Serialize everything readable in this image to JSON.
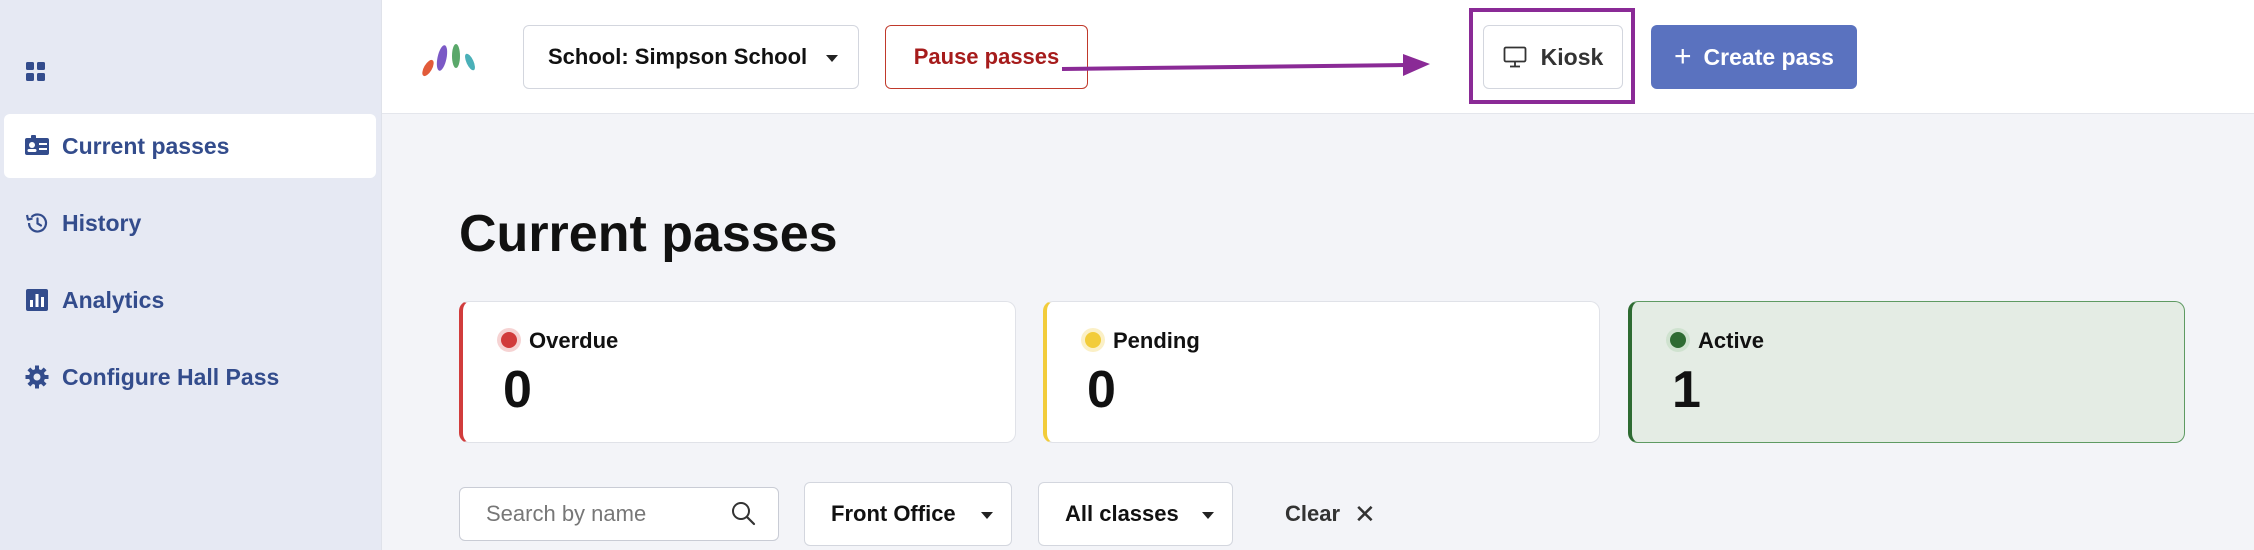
{
  "sidebar": {
    "items": [
      {
        "label": "Current passes",
        "icon": "badge-icon",
        "active": true
      },
      {
        "label": "History",
        "icon": "history-icon"
      },
      {
        "label": "Analytics",
        "icon": "bar-chart-icon"
      },
      {
        "label": "Configure Hall Pass",
        "icon": "gear-icon"
      }
    ]
  },
  "topbar": {
    "school_select": "School: Simpson School",
    "pause_label": "Pause passes",
    "kiosk_label": "Kiosk",
    "create_label": "Create pass"
  },
  "main": {
    "title": "Current passes",
    "cards": [
      {
        "label": "Overdue",
        "count": "0",
        "color": "#d13c3c"
      },
      {
        "label": "Pending",
        "count": "0",
        "color": "#f2cc3a"
      },
      {
        "label": "Active",
        "count": "1",
        "color": "#2e6b32"
      }
    ],
    "filters": {
      "search_placeholder": "Search by name",
      "location": "Front Office",
      "classes": "All classes",
      "clear_label": "Clear"
    }
  },
  "colors": {
    "accent": "#5a72bf",
    "nav_text": "#334c8c",
    "annotation": "#8a2a96",
    "pause": "#a61c1c"
  }
}
